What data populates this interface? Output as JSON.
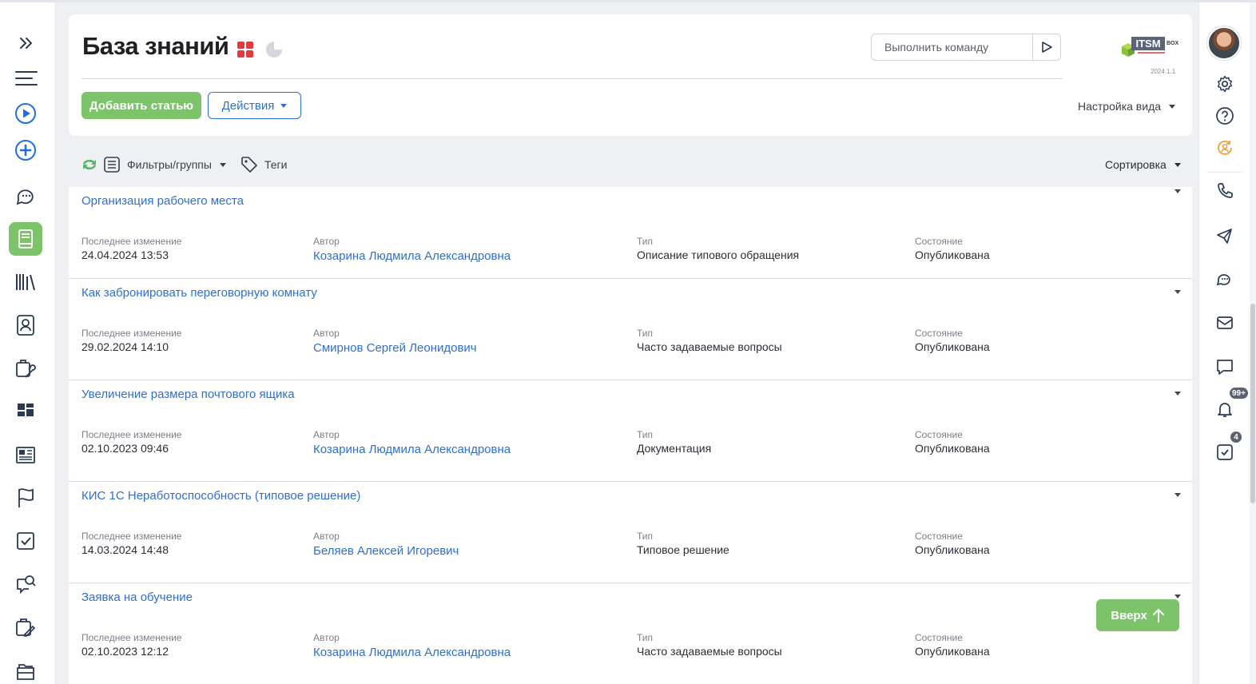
{
  "page": {
    "title": "База знаний",
    "command_placeholder": "Выполнить команду",
    "logo_text": "ITSM",
    "logo_sub": "BOX",
    "version": "2024.1.1",
    "add_button": "Добавить статью",
    "actions_button": "Действия",
    "view_settings": "Настройка вида"
  },
  "filterbar": {
    "filters_label": "Фильтры/группы",
    "tags_label": "Теги",
    "sort_label": "Сортировка"
  },
  "labels": {
    "last_change": "Последнее изменение",
    "author": "Автор",
    "type": "Тип",
    "state": "Состояние"
  },
  "articles": [
    {
      "title": "Организация рабочего места",
      "date": "24.04.2024 13:53",
      "author": "Козарина Людмила Александровна",
      "type": "Описание типового обращения",
      "state": "Опубликована"
    },
    {
      "title": "Как забронировать переговорную комнату",
      "date": "29.02.2024 14:10",
      "author": "Смирнов Сергей Леонидович",
      "type": "Часто задаваемые вопросы",
      "state": "Опубликована"
    },
    {
      "title": "Увеличение размера почтового ящика",
      "date": "02.10.2023 09:46",
      "author": "Козарина Людмила Александровна",
      "type": "Документация",
      "state": "Опубликована"
    },
    {
      "title": "КИС 1С Неработоспособность (типовое решение)",
      "date": "14.03.2024 14:48",
      "author": "Беляев Алексей Игоревич",
      "type": "Типовое решение",
      "state": "Опубликована"
    },
    {
      "title": "Заявка на обучение",
      "date": "02.10.2023 12:12",
      "author": "Козарина Людмила Александровна",
      "type": "Часто задаваемые вопросы",
      "state": "Опубликована"
    }
  ],
  "scroll_up_button": "Вверх",
  "badges": {
    "notifications": "99+",
    "tasks": "4"
  },
  "colors": {
    "accent_green": "#7cc36a",
    "link_blue": "#2f6fd0",
    "icon_blue": "#1f6fe0",
    "red_tiles": "#e23b3b",
    "orange": "#f0a030"
  }
}
